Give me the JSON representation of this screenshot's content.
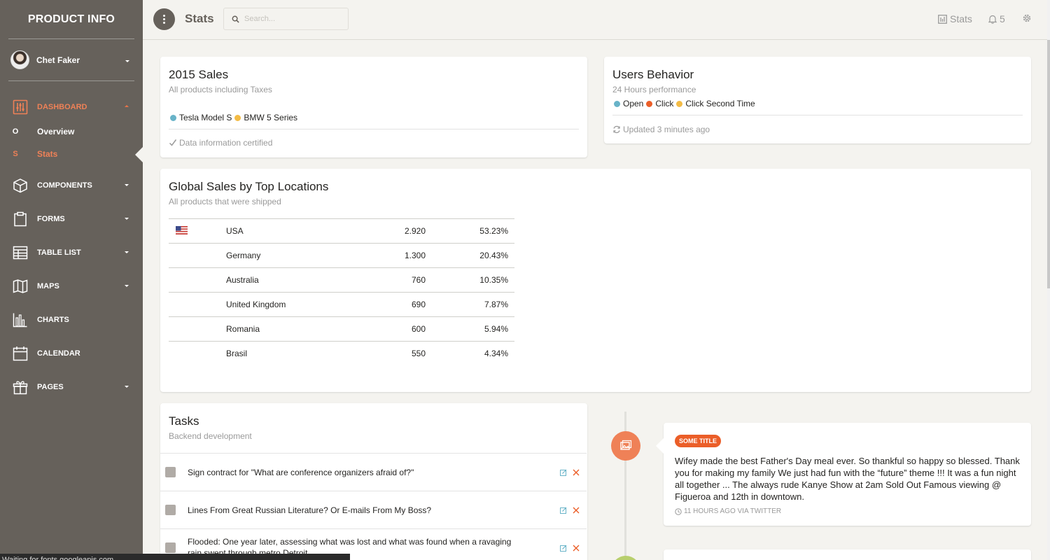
{
  "sidebar": {
    "brand": "PRODUCT INFO",
    "user_name": "Chet Faker",
    "dashboard_label": "DASHBOARD",
    "sub_items": [
      {
        "mini": "O",
        "label": "Overview"
      },
      {
        "mini": "S",
        "label": "Stats"
      }
    ],
    "items": [
      {
        "label": "COMPONENTS",
        "icon": "box-icon"
      },
      {
        "label": "FORMS",
        "icon": "clipboard-icon"
      },
      {
        "label": "TABLE LIST",
        "icon": "table-icon"
      },
      {
        "label": "MAPS",
        "icon": "map-icon"
      },
      {
        "label": "CHARTS",
        "icon": "chart-icon"
      },
      {
        "label": "CALENDAR",
        "icon": "calendar-icon"
      },
      {
        "label": "PAGES",
        "icon": "gift-icon"
      }
    ]
  },
  "topbar": {
    "title": "Stats",
    "search_placeholder": "Search...",
    "stats_label": "Stats",
    "notification_count": "5"
  },
  "sales_card": {
    "title": "2015 Sales",
    "category": "All products including Taxes",
    "legend": [
      {
        "label": "Tesla Model S",
        "color": "#68b3c8"
      },
      {
        "label": "BMW 5 Series",
        "color": "#f3bb45"
      }
    ],
    "footer": "Data information certified"
  },
  "behavior_card": {
    "title": "Users Behavior",
    "category": "24 Hours performance",
    "legend": [
      {
        "label": "Open",
        "color": "#68b3c8"
      },
      {
        "label": "Click",
        "color": "#eb5e28"
      },
      {
        "label": "Click Second Time",
        "color": "#f3bb45"
      }
    ],
    "footer": "Updated 3 minutes ago"
  },
  "locations_card": {
    "title": "Global Sales by Top Locations",
    "category": "All products that were shipped",
    "rows": [
      {
        "country": "USA",
        "value": "2.920",
        "percent": "53.23%",
        "flag": true
      },
      {
        "country": "Germany",
        "value": "1.300",
        "percent": "20.43%",
        "flag": false
      },
      {
        "country": "Australia",
        "value": "760",
        "percent": "10.35%",
        "flag": false
      },
      {
        "country": "United Kingdom",
        "value": "690",
        "percent": "7.87%",
        "flag": false
      },
      {
        "country": "Romania",
        "value": "600",
        "percent": "5.94%",
        "flag": false
      },
      {
        "country": "Brasil",
        "value": "550",
        "percent": "4.34%",
        "flag": false
      }
    ]
  },
  "tasks_card": {
    "title": "Tasks",
    "category": "Backend development",
    "tasks": [
      "Sign contract for \"What are conference organizers afraid of?\"",
      "Lines From Great Russian Literature? Or E-mails From My Boss?",
      "Flooded: One year later, assessing what was lost and what was found when a ravaging rain swept through metro Detroit"
    ]
  },
  "timeline": {
    "badge": "SOME TITLE",
    "body": "Wifey made the best Father's Day meal ever. So thankful so happy so blessed. Thank you for making my family We just had fun with the “future” theme !!! It was a fun night all together ... The always rude Kanye Show at 2am Sold Out Famous viewing @ Figueroa and 12th in downtown.",
    "footer": "11 HOURS AGO VIA TWITTER"
  },
  "status_bar": "Waiting for fonts.googleapis.com..."
}
